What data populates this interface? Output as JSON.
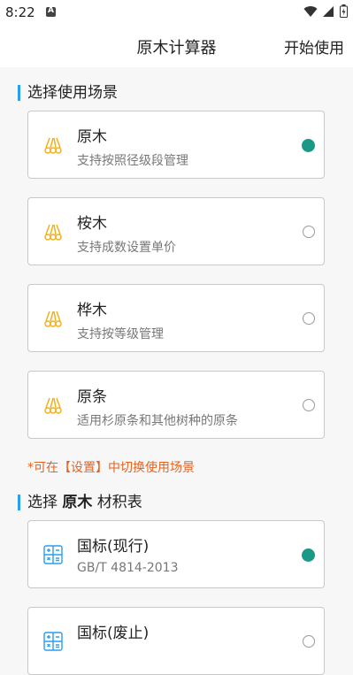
{
  "status": {
    "time": "8:22"
  },
  "appbar": {
    "title": "原木计算器",
    "action": "开始使用"
  },
  "scene_section": {
    "title": "选择使用场景"
  },
  "scenes": [
    {
      "name": "原木",
      "desc": "支持按照径级段管理",
      "selected": true
    },
    {
      "name": "桉木",
      "desc": "支持成数设置单价",
      "selected": false
    },
    {
      "name": "桦木",
      "desc": "支持按等级管理",
      "selected": false
    },
    {
      "name": "原条",
      "desc": "适用杉原条和其他树种的原条",
      "selected": false
    }
  ],
  "hint": "*可在【设置】中切换使用场景",
  "table_section": {
    "prefix": "选择 ",
    "bold": "原木",
    "suffix": " 材积表"
  },
  "tables": [
    {
      "name": "国标(现行)",
      "desc": "GB/T 4814-2013",
      "selected": true
    },
    {
      "name": "国标(废止)",
      "desc": "",
      "selected": false
    }
  ],
  "colors": {
    "accent": "#1a9a86",
    "section_bar": "#2a9df4",
    "hint": "#e5621f",
    "icon": "#f2b01e"
  }
}
